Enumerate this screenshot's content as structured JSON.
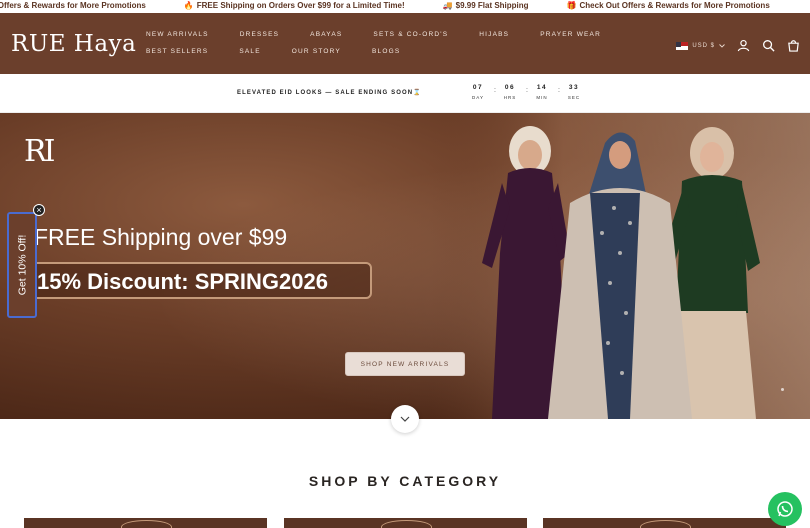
{
  "announcement": {
    "items": [
      {
        "emoji": "",
        "text": "ut Offers & Rewards for More Promotions"
      },
      {
        "emoji": "🔥",
        "text": "FREE Shipping on Orders Over $99 for a Limited Time!"
      },
      {
        "emoji": "🚚",
        "text": "$9.99 Flat Shipping"
      },
      {
        "emoji": "🎁",
        "text": "Check Out Offers & Rewards for More Promotions"
      }
    ]
  },
  "header": {
    "logo": "RUE Haya",
    "nav": [
      "NEW ARRIVALS",
      "DRESSES",
      "ABAYAS",
      "SETS & CO-ORD'S",
      "HIJABS",
      "PRAYER WEAR",
      "BEST SELLERS",
      "SALE",
      "OUR STORY",
      "BLOGS"
    ],
    "currency": "USD $",
    "icons": [
      "user-icon",
      "search-icon",
      "bag-icon"
    ]
  },
  "countdown": {
    "text": "ELEVATED EID LOOKS — SALE ENDING SOON⌛",
    "units": [
      {
        "value": "07",
        "label": "DAY"
      },
      {
        "value": "06",
        "label": "HRS"
      },
      {
        "value": "14",
        "label": "MIN"
      },
      {
        "value": "33",
        "label": "SEC"
      }
    ]
  },
  "hero": {
    "logo": "RI",
    "line1": "FREE Shipping over $99",
    "line2": "15% Discount: SPRING2026",
    "button": "SHOP NEW ARRIVALS"
  },
  "side_tab": {
    "label": "Get 10% Off!",
    "close": "×"
  },
  "section": {
    "title": "SHOP BY CATEGORY"
  },
  "colors": {
    "brand": "#6b3f2c",
    "accent": "#c49a7a",
    "whatsapp": "#25c160"
  }
}
